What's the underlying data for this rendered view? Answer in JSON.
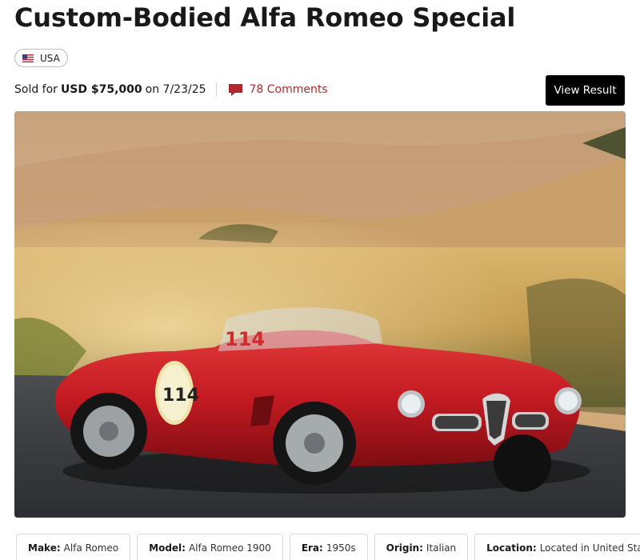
{
  "listing": {
    "title": "Custom-Bodied Alfa Romeo Special",
    "country": "USA",
    "sold_prefix": "Sold for",
    "sold_price": "USD $75,000",
    "sold_date_text": "on 7/23/25",
    "comments_label": "78 Comments",
    "view_result_label": "View Result",
    "photo": {
      "description_icon": "car-photo",
      "race_number": "114"
    }
  },
  "specs": [
    {
      "key": "Make:",
      "value": "Alfa Romeo"
    },
    {
      "key": "Model:",
      "value": "Alfa Romeo 1900"
    },
    {
      "key": "Era:",
      "value": "1950s"
    },
    {
      "key": "Origin:",
      "value": "Italian"
    },
    {
      "key": "Location:",
      "value": "Located in United States"
    }
  ],
  "colors": {
    "accent": "#b3282d",
    "button_bg": "#000000",
    "button_text": "#ffffff",
    "car_red": "#c41a22"
  },
  "icons": {
    "flag": "us-flag-icon",
    "comments": "comment-bubble-icon"
  }
}
